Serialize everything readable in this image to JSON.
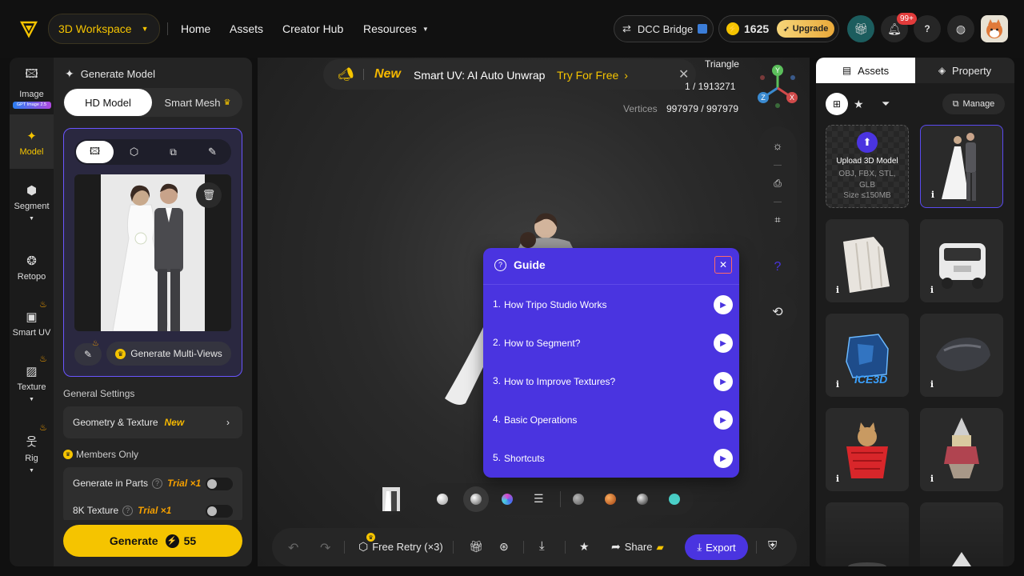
{
  "header": {
    "workspace_label": "3D Workspace",
    "nav": [
      "Home",
      "Assets",
      "Creator Hub",
      "Resources"
    ],
    "dcc_label": "DCC Bridge",
    "credits": "1625",
    "upgrade_label": "Upgrade",
    "notification_badge": "99+"
  },
  "rail": {
    "items": [
      {
        "label": "Image",
        "badge": "GPT Image 2.5"
      },
      {
        "label": "Model"
      },
      {
        "label": "Segment"
      },
      {
        "label": "Retopo"
      },
      {
        "label": "Smart UV"
      },
      {
        "label": "Texture"
      },
      {
        "label": "Rig"
      }
    ]
  },
  "panel": {
    "title": "Generate Model",
    "mode_tabs": [
      "HD Model",
      "Smart Mesh"
    ],
    "multiview_label": "Generate Multi-Views",
    "general_settings_label": "General Settings",
    "geometry_label": "Geometry & Texture",
    "geometry_tag": "New",
    "members_label": "Members Only",
    "parts_label": "Generate in Parts",
    "parts_trial": "Trial ×1",
    "k8_label": "8K Texture",
    "k8_trial": "Trial ×1",
    "generate_label": "Generate",
    "generate_cost": "55"
  },
  "banner": {
    "tag": "New",
    "text": "Smart UV: AI Auto Unwrap",
    "cta": "Try For Free"
  },
  "stats": {
    "triangle_label": "Triangle",
    "triangle_value": "1 / 1913271",
    "vertices_label": "Vertices",
    "vertices_value": "997979 / 997979"
  },
  "axes": {
    "y": "Y",
    "z": "Z",
    "x": "X"
  },
  "guide": {
    "title": "Guide",
    "items": [
      {
        "num": "1.",
        "label": "How Tripo Studio Works"
      },
      {
        "num": "2.",
        "label": "How to Segment?"
      },
      {
        "num": "3.",
        "label": "How to Improve Textures?"
      },
      {
        "num": "4.",
        "label": "Basic Operations"
      },
      {
        "num": "5.",
        "label": "Shortcuts"
      }
    ]
  },
  "bottombar": {
    "retry_label": "Free Retry (×3)",
    "share_label": "Share",
    "export_label": "Export"
  },
  "rpanel": {
    "tabs": [
      "Assets",
      "Property"
    ],
    "manage_label": "Manage",
    "upload_title": "Upload 3D Model",
    "upload_formats": "OBJ, FBX, STL, GLB",
    "upload_size": "Size ≤150MB",
    "thumb_texts": [
      "ICE3D"
    ]
  },
  "colors": {
    "accent": "#4a34e0",
    "gold": "#f5c400",
    "new_tag": "#f5b800"
  }
}
